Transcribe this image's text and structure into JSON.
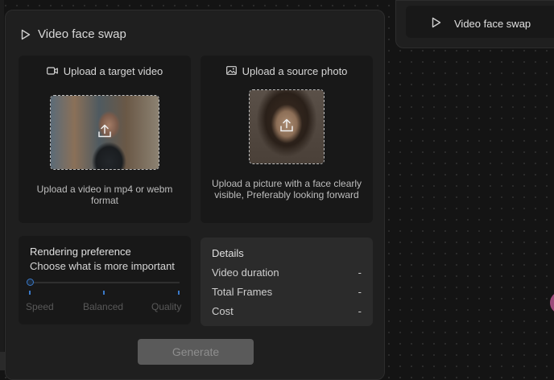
{
  "main_node": {
    "title": "Video face swap",
    "title_icon": "play-icon",
    "target_video": {
      "title": "Upload a target video",
      "icon": "video-camera-icon",
      "description": "Upload a video in mp4 or webm format"
    },
    "source_photo": {
      "title": "Upload a source photo",
      "icon": "image-icon",
      "description": "Upload a picture with a face clearly visible, Preferably looking forward"
    },
    "rendering_preference": {
      "title": "Rendering preference",
      "subtitle": "Choose what is more important",
      "options": [
        "Speed",
        "Balanced",
        "Quality"
      ],
      "selected": "Speed",
      "accent_color": "#3a79c9"
    },
    "details": {
      "title": "Details",
      "rows": [
        {
          "label": "Video duration",
          "value": "-"
        },
        {
          "label": "Total Frames",
          "value": "-"
        },
        {
          "label": "Cost",
          "value": "-"
        }
      ]
    },
    "generate_label": "Generate"
  },
  "secondary_node": {
    "title": "Video face swap",
    "title_icon": "play-icon"
  }
}
